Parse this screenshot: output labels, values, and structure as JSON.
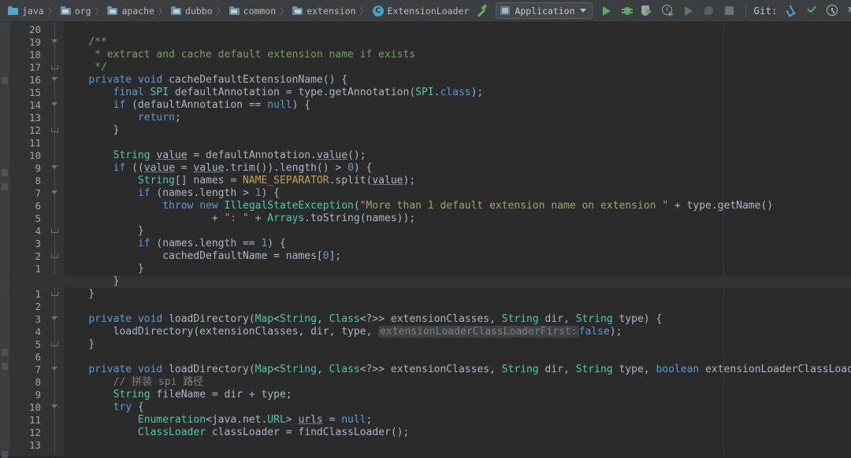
{
  "window": {
    "app": "IntelliJ IDEA",
    "theme_bg": "#2b2b2b",
    "toolbar_bg": "#3c3f41",
    "accent_green": "#59a869",
    "accent_blue": "#4f9ed6"
  },
  "breadcrumb": {
    "items": [
      {
        "label": "java",
        "icon": "folder-src-icon"
      },
      {
        "label": "org",
        "icon": "folder-package-icon"
      },
      {
        "label": "apache",
        "icon": "folder-package-icon"
      },
      {
        "label": "dubbo",
        "icon": "folder-package-icon"
      },
      {
        "label": "common",
        "icon": "folder-package-icon"
      },
      {
        "label": "extension",
        "icon": "folder-package-icon"
      },
      {
        "label": "ExtensionLoader",
        "icon": "java-class-icon"
      }
    ],
    "separator": "〉"
  },
  "toolbar": {
    "build_tooltip": "Build Project",
    "run_config": {
      "label": "Application",
      "icon": "module-icon",
      "caret": "chevron-down-icon"
    },
    "actions": [
      {
        "name": "run-button",
        "state": "enabled"
      },
      {
        "name": "debug-button",
        "state": "enabled"
      },
      {
        "name": "run-with-coverage-button",
        "state": "enabled"
      },
      {
        "name": "profile-button",
        "state": "enabled"
      },
      {
        "name": "run-secondary-button",
        "state": "disabled"
      },
      {
        "name": "attach-process-button",
        "state": "disabled"
      },
      {
        "name": "stop-button",
        "state": "disabled"
      }
    ],
    "git": {
      "label": "Git:",
      "buttons": [
        {
          "name": "update-project-button",
          "icon": "update-arrow-icon"
        },
        {
          "name": "commit-button",
          "icon": "checkmark-icon"
        },
        {
          "name": "show-history-button",
          "icon": "clock-icon"
        },
        {
          "name": "rollback-button",
          "icon": "revert-arrow-icon"
        }
      ]
    }
  },
  "editor": {
    "file": "ExtensionLoader.java",
    "language": "Java",
    "line_numbering": "relative",
    "right_margin_column": 120,
    "current_line_index": 20,
    "line_numbers": [
      "20",
      "19",
      "18",
      "17",
      "16",
      "15",
      "14",
      "13",
      "12",
      "11",
      "10",
      "9",
      "8",
      "7",
      "6",
      "5",
      "4",
      "3",
      "2",
      "1",
      "",
      "1",
      "2",
      "3",
      "4",
      "5",
      "6",
      "7",
      "8",
      "9",
      "10",
      "11",
      "12",
      "13"
    ],
    "fold_markers": [
      {
        "row": 1,
        "type": "down"
      },
      {
        "row": 3,
        "type": "end"
      },
      {
        "row": 4,
        "type": "down"
      },
      {
        "row": 6,
        "type": "down"
      },
      {
        "row": 8,
        "type": "end"
      },
      {
        "row": 11,
        "type": "down"
      },
      {
        "row": 13,
        "type": "down"
      },
      {
        "row": 16,
        "type": "end"
      },
      {
        "row": 18,
        "type": "end"
      },
      {
        "row": 20,
        "type": "end"
      },
      {
        "row": 21,
        "type": "end"
      },
      {
        "row": 23,
        "type": "down"
      },
      {
        "row": 25,
        "type": "end"
      },
      {
        "row": 27,
        "type": "down"
      },
      {
        "row": 30,
        "type": "down"
      }
    ],
    "lines": [
      {
        "row": 0,
        "text": ""
      },
      {
        "row": 1,
        "text": "    /**"
      },
      {
        "row": 2,
        "text": "     * extract and cache default extension name if exists"
      },
      {
        "row": 3,
        "text": "     */"
      },
      {
        "row": 4,
        "text": "    private void cacheDefaultExtensionName() {"
      },
      {
        "row": 5,
        "text": "        final SPI defaultAnnotation = type.getAnnotation(SPI.class);"
      },
      {
        "row": 6,
        "text": "        if (defaultAnnotation == null) {"
      },
      {
        "row": 7,
        "text": "            return;"
      },
      {
        "row": 8,
        "text": "        }"
      },
      {
        "row": 9,
        "text": ""
      },
      {
        "row": 10,
        "text": "        String value = defaultAnnotation.value();"
      },
      {
        "row": 11,
        "text": "        if ((value = value.trim()).length() > 0) {"
      },
      {
        "row": 12,
        "text": "            String[] names = NAME_SEPARATOR.split(value);"
      },
      {
        "row": 13,
        "text": "            if (names.length > 1) {"
      },
      {
        "row": 14,
        "text": "                throw new IllegalStateException(\"More than 1 default extension name on extension \" + type.getName()"
      },
      {
        "row": 15,
        "text": "                        + \": \" + Arrays.toString(names));"
      },
      {
        "row": 16,
        "text": "            }"
      },
      {
        "row": 17,
        "text": "            if (names.length == 1) {"
      },
      {
        "row": 18,
        "text": "                cachedDefaultName = names[0];"
      },
      {
        "row": 19,
        "text": "            }"
      },
      {
        "row": 20,
        "text": "        }"
      },
      {
        "row": 21,
        "text": "    }"
      },
      {
        "row": 22,
        "text": ""
      },
      {
        "row": 23,
        "text": "    private void loadDirectory(Map<String, Class<?>> extensionClasses, String dir, String type) {"
      },
      {
        "row": 24,
        "text": "        loadDirectory(extensionClasses, dir, type, extensionLoaderClassLoaderFirst: false);"
      },
      {
        "row": 25,
        "text": "    }"
      },
      {
        "row": 26,
        "text": ""
      },
      {
        "row": 27,
        "text": "    private void loadDirectory(Map<String, Class<?>> extensionClasses, String dir, String type, boolean extensionLoaderClassLoaderFirst) {"
      },
      {
        "row": 28,
        "text": "        // 拼装 spi 路径"
      },
      {
        "row": 29,
        "text": "        String fileName = dir + type;"
      },
      {
        "row": 30,
        "text": "        try {"
      },
      {
        "row": 31,
        "text": "            Enumeration<java.net.URL> urls = null;"
      },
      {
        "row": 32,
        "text": "            ClassLoader classLoader = findClassLoader();"
      }
    ],
    "inlay_hints": [
      {
        "row": 24,
        "text": "extensionLoaderClassLoaderFirst:",
        "value": "false"
      }
    ]
  }
}
